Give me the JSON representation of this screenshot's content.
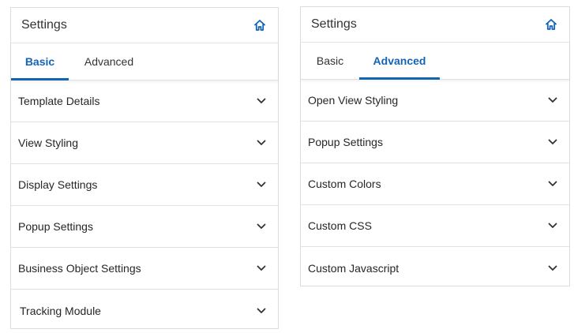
{
  "left_panel": {
    "title": "Settings",
    "tabs": [
      {
        "label": "Basic",
        "active": true
      },
      {
        "label": "Advanced",
        "active": false
      }
    ],
    "rows": [
      {
        "label": "Template Details"
      },
      {
        "label": "View Styling"
      },
      {
        "label": "Display Settings"
      },
      {
        "label": "Popup Settings"
      },
      {
        "label": "Business Object Settings"
      },
      {
        "label": "Tracking Module"
      }
    ]
  },
  "right_panel": {
    "title": "Settings",
    "tabs": [
      {
        "label": "Basic",
        "active": false
      },
      {
        "label": "Advanced",
        "active": true
      }
    ],
    "rows": [
      {
        "label": "Open View Styling"
      },
      {
        "label": "Popup Settings"
      },
      {
        "label": "Custom Colors"
      },
      {
        "label": "Custom CSS"
      },
      {
        "label": "Custom Javascript"
      }
    ]
  },
  "icons": {
    "home": "home-icon",
    "expand": "chevron-down-icon"
  },
  "colors": {
    "accent": "#1464b4",
    "border": "#dcdcdc"
  }
}
